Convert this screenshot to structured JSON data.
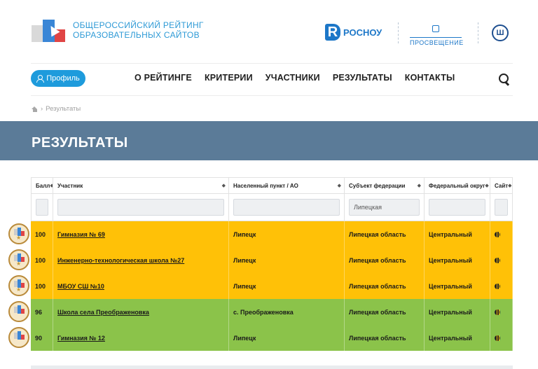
{
  "header": {
    "logo_line1": "Общероссийский рейтинг",
    "logo_line2": "образовательных сайтов",
    "partner_rosnou_letter": "R",
    "partner_rosnou": "РОСНОУ",
    "partner_prosv": "ПРОСВЕЩЕНИЕ",
    "partner_hse": "Ш"
  },
  "nav": {
    "profile": "Профиль",
    "items": [
      "О РЕЙТИНГЕ",
      "КРИТЕРИИ",
      "УЧАСТНИКИ",
      "РЕЗУЛЬТАТЫ",
      "КОНТАКТЫ"
    ]
  },
  "breadcrumb": {
    "sep": "›",
    "current": "Результаты"
  },
  "banner": {
    "title": "РЕЗУЛЬТАТЫ"
  },
  "table": {
    "headers": [
      "Балл",
      "Участник",
      "Населенный пункт / АО",
      "Субъект федерации",
      "Федеральный округ",
      "Сайт"
    ],
    "filter_region": "Липецкая",
    "rows": [
      {
        "score": "100",
        "name": "Гимназия № 69",
        "city": "Липецк",
        "region": "Липецкая область",
        "district": "Центральный",
        "color": "#ffc107"
      },
      {
        "score": "100",
        "name": "Инженерно-технологическая школа №27",
        "city": "Липецк",
        "region": "Липецкая область",
        "district": "Центральный",
        "color": "#ffc107"
      },
      {
        "score": "100",
        "name": "МБОУ СШ №10",
        "city": "Липецк",
        "region": "Липецкая область",
        "district": "Центральный",
        "color": "#ffc107"
      },
      {
        "score": "96",
        "name": "Школа села Преображеновка",
        "city": "с. Преображеновка",
        "region": "Липецкая область",
        "district": "Центральный",
        "color": "#8bc34a"
      },
      {
        "score": "90",
        "name": "Гимназия № 12",
        "city": "Липецк",
        "region": "Липецкая область",
        "district": "Центральный",
        "color": "#8bc34a"
      }
    ]
  },
  "icons": [
    "home-icon",
    "search-icon",
    "user-icon",
    "globe-icon",
    "sort-icon",
    "medal-icon"
  ]
}
